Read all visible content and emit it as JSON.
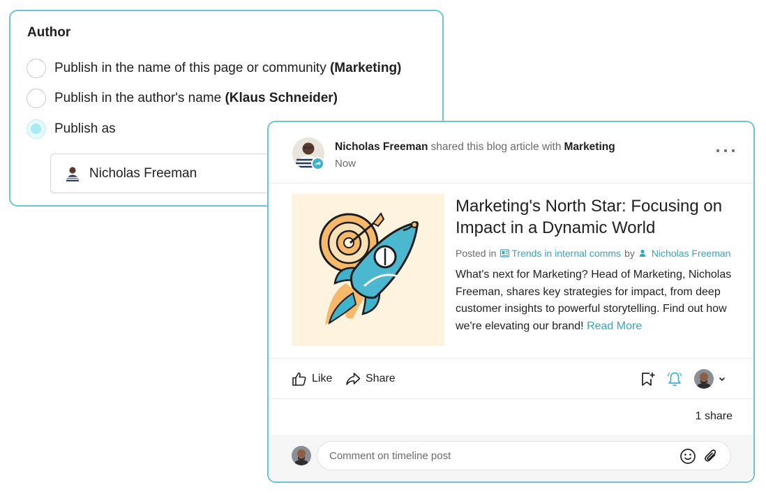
{
  "author_panel": {
    "title": "Author",
    "options": [
      {
        "text": "Publish in the name of this page or community ",
        "bold": "(Marketing)",
        "selected": false
      },
      {
        "text": "Publish in the author's name ",
        "bold": "(Klaus Schneider)",
        "selected": false
      },
      {
        "text": "Publish as",
        "bold": "",
        "selected": true
      }
    ],
    "publish_as": {
      "selected_value": "Nicholas Freeman",
      "avatar_icon": "user-avatar"
    }
  },
  "post": {
    "author": "Nicholas Freeman",
    "action_text": "shared this blog article with",
    "target": "Marketing",
    "time": "Now",
    "article": {
      "title": "Marketing's North Star: Focusing on Impact in a Dynamic World",
      "posted_in_label": "Posted in",
      "category": "Trends in internal comms",
      "by_label": "by",
      "author": "Nicholas Freeman",
      "excerpt": "What's next for Marketing? Head of Marketing, Nicholas Freeman, shares key strategies for impact, from deep customer insights to powerful storytelling. Find out how we're elevating our brand!",
      "read_more": "Read More",
      "image_icon": "rocket-target-illustration"
    },
    "actions": {
      "like": "Like",
      "share": "Share"
    },
    "share_count": "1 share",
    "comment": {
      "placeholder": "Comment on timeline post"
    }
  },
  "colors": {
    "accent": "#2fa8c1",
    "card_border": "#6cc5d3",
    "radio_selected": "#a8eaf6",
    "hero_bg": "#fdf3df"
  }
}
